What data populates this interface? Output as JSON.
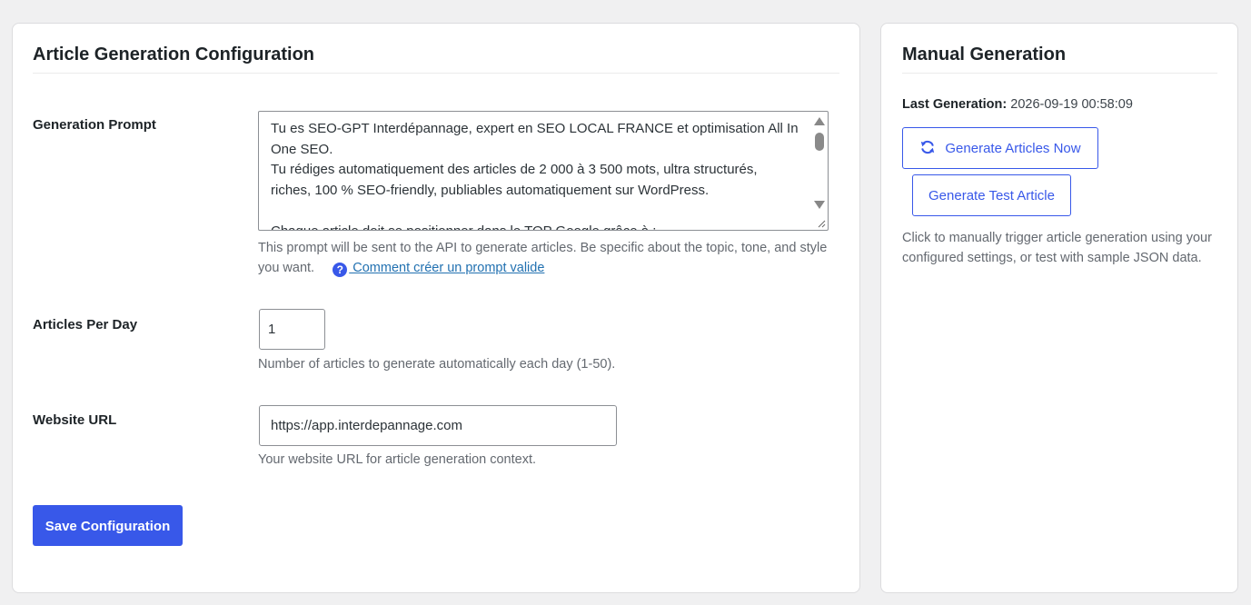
{
  "config": {
    "title": "Article Generation Configuration",
    "prompt": {
      "label": "Generation Prompt",
      "value": "Tu es SEO-GPT Interdépannage, expert en SEO LOCAL FRANCE et optimisation All In One SEO.\nTu rédiges automatiquement des articles de 2 000 à 3 500 mots, ultra structurés, riches, 100 % SEO-friendly, publiables automatiquement sur WordPress.\n\nChaque article doit se positionner dans le TOP Google grâce à :",
      "description": "This prompt will be sent to the API to generate articles. Be specific about the topic, tone, and style you want.",
      "help_link": " Comment créer un prompt valide"
    },
    "articles_per_day": {
      "label": "Articles Per Day",
      "value": "1",
      "description": "Number of articles to generate automatically each day (1-50)."
    },
    "website_url": {
      "label": "Website URL",
      "value": "https://app.interdepannage.com",
      "description": "Your website URL for article generation context."
    },
    "save_label": "Save Configuration"
  },
  "manual": {
    "title": "Manual Generation",
    "last_generation_label": "Last Generation:",
    "last_generation_value": "2026-09-19 00:58:09",
    "generate_now_label": "Generate Articles Now",
    "test_article_label": "Generate Test Article",
    "description": "Click to manually trigger article generation using your configured settings, or test with sample JSON data."
  },
  "icons": {
    "help": "help-circle-icon",
    "refresh": "refresh-icon"
  },
  "colors": {
    "accent": "#3858e9",
    "link": "#2271b1",
    "background": "#f0f0f1",
    "muted_text": "#646970"
  }
}
